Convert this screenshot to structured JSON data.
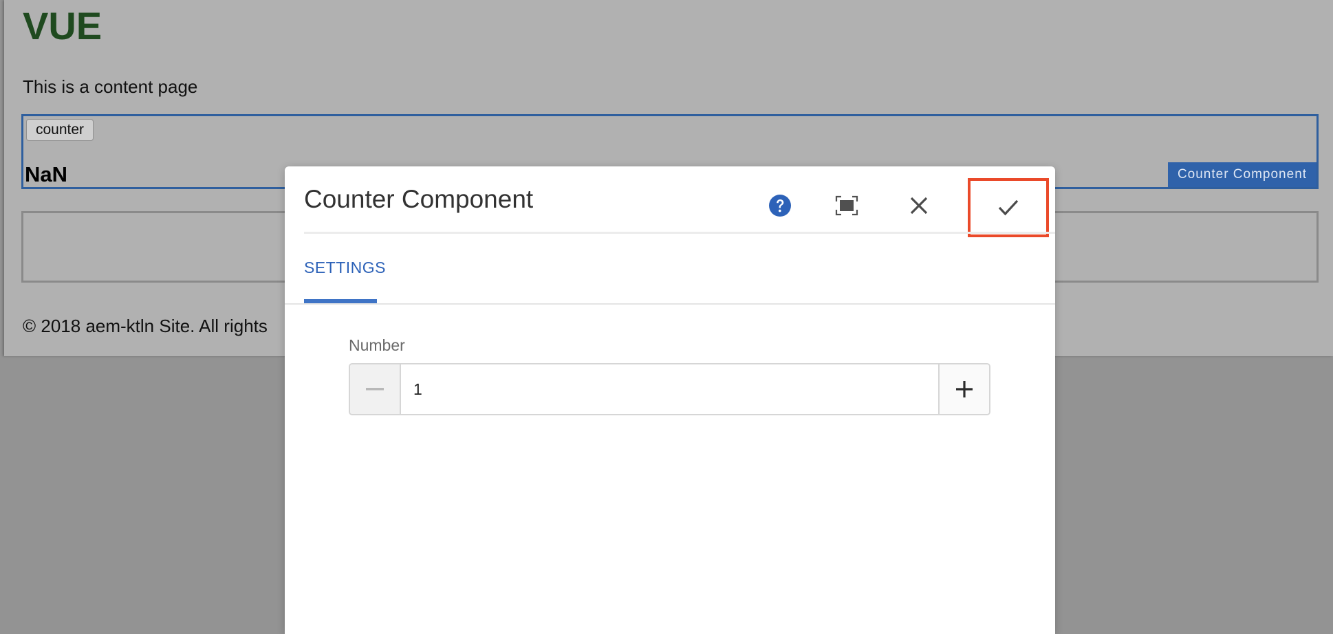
{
  "page": {
    "title": "VUE",
    "content_text": "This is a content page",
    "counter_button_label": "counter",
    "counter_value": "NaN",
    "component_tag": "Counter Component",
    "footer": "© 2018 aem-ktln Site. All rights"
  },
  "dialog": {
    "title": "Counter Component",
    "tabs": [
      {
        "label": "SETTINGS",
        "active": true
      }
    ],
    "field": {
      "label": "Number",
      "value": "1"
    },
    "icons": {
      "help": "help-icon",
      "fullscreen": "fullscreen-icon",
      "close": "close-icon",
      "done": "checkmark-icon",
      "decrement": "minus-icon",
      "increment": "plus-icon"
    }
  },
  "colors": {
    "accent": "#2d62b8",
    "highlight_border": "#ea4a2a",
    "component_tag_bg": "#2f62aa",
    "title_green": "#1f4a1f"
  }
}
